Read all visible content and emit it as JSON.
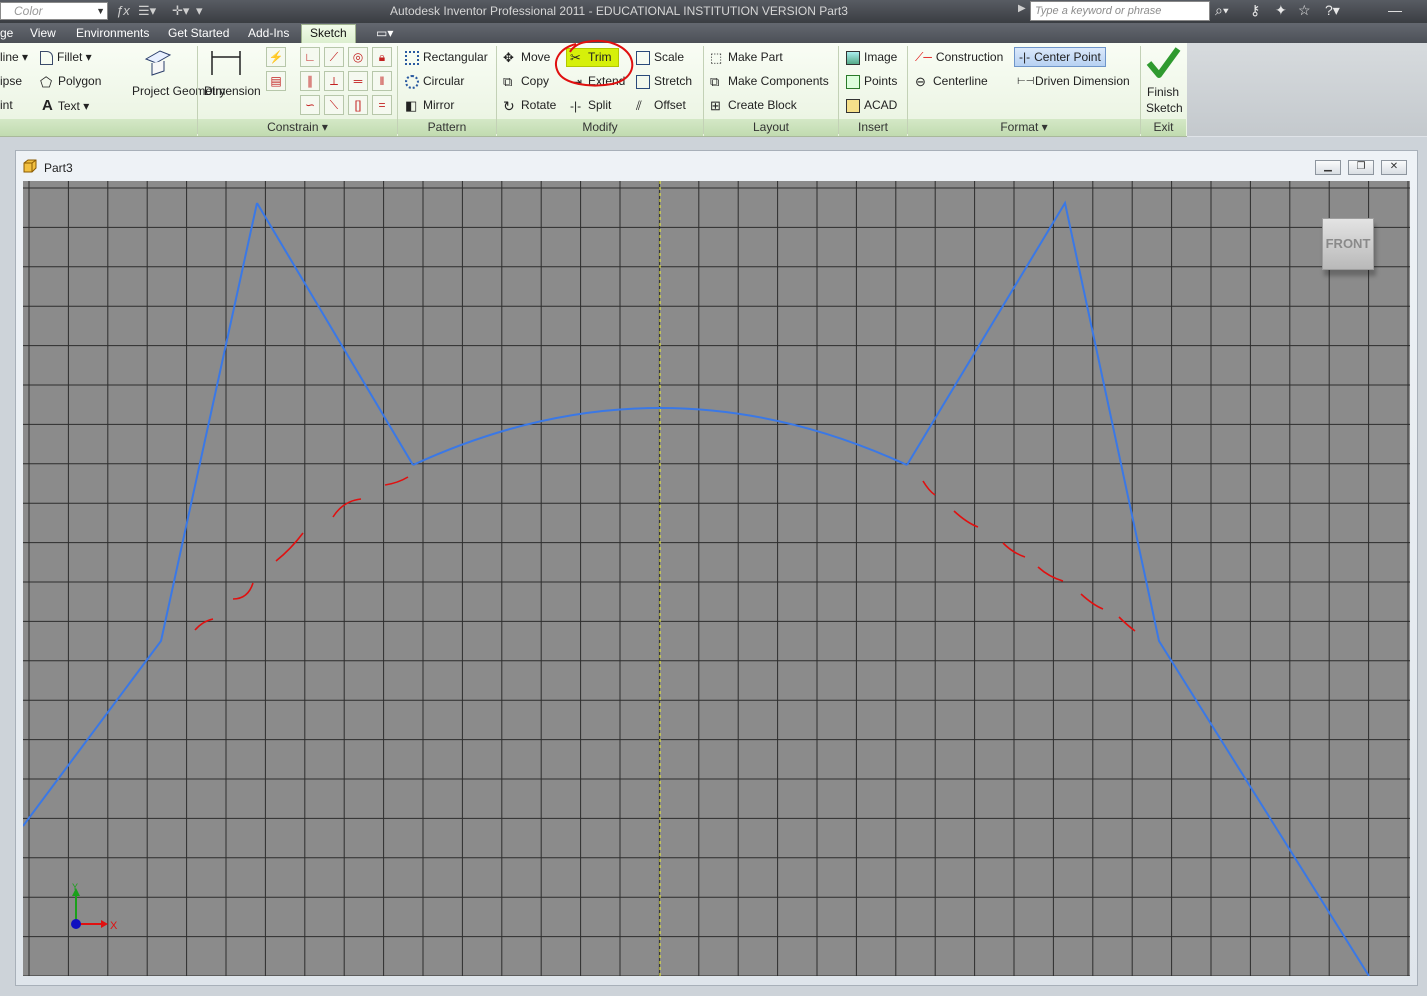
{
  "titlebar": {
    "color_value": "Color",
    "title": "Autodesk Inventor Professional 2011 - EDUCATIONAL INSTITUTION VERSION    Part3",
    "search_placeholder": "Type a keyword or phrase"
  },
  "tabs": [
    "ge",
    "View",
    "Environments",
    "Get Started",
    "Add-Ins",
    "Sketch"
  ],
  "active_tab": "Sketch",
  "ribbon": {
    "draw": {
      "line": "line",
      "ellipse": "ipse",
      "point": "int",
      "fillet": "Fillet",
      "polygon": "Polygon",
      "text": "Text",
      "project_geometry": "Project Geometry"
    },
    "constrain": {
      "dimension": "Dimension",
      "label": "Constrain"
    },
    "pattern": {
      "rectangular": "Rectangular",
      "circular": "Circular",
      "mirror": "Mirror",
      "label": "Pattern"
    },
    "modify": {
      "move": "Move",
      "copy": "Copy",
      "rotate": "Rotate",
      "trim": "Trim",
      "extend": "Extend",
      "split": "Split",
      "scale": "Scale",
      "stretch": "Stretch",
      "offset": "Offset",
      "label": "Modify"
    },
    "layout": {
      "make_part": "Make Part",
      "make_components": "Make Components",
      "create_block": "Create Block",
      "label": "Layout"
    },
    "insert": {
      "image": "Image",
      "points": "Points",
      "acad": "ACAD",
      "label": "Insert"
    },
    "format": {
      "construction": "Construction",
      "centerline": "Centerline",
      "center_point": "Center Point",
      "driven_dimension": "Driven Dimension",
      "label": "Format"
    },
    "exit": {
      "finish_sketch_1": "Finish",
      "finish_sketch_2": "Sketch",
      "label": "Exit"
    }
  },
  "document": {
    "title": "Part3",
    "viewcube_face": "FRONT",
    "axis_x": "X",
    "axis_y": "Y"
  },
  "colors": {
    "sketch_line": "#3a78e6",
    "annotation": "#e01010",
    "centerline": "#e6e640",
    "grid_bg": "#8c8c8c",
    "grid_line": "#2a2a2a",
    "highlight": "#d6f00a"
  }
}
